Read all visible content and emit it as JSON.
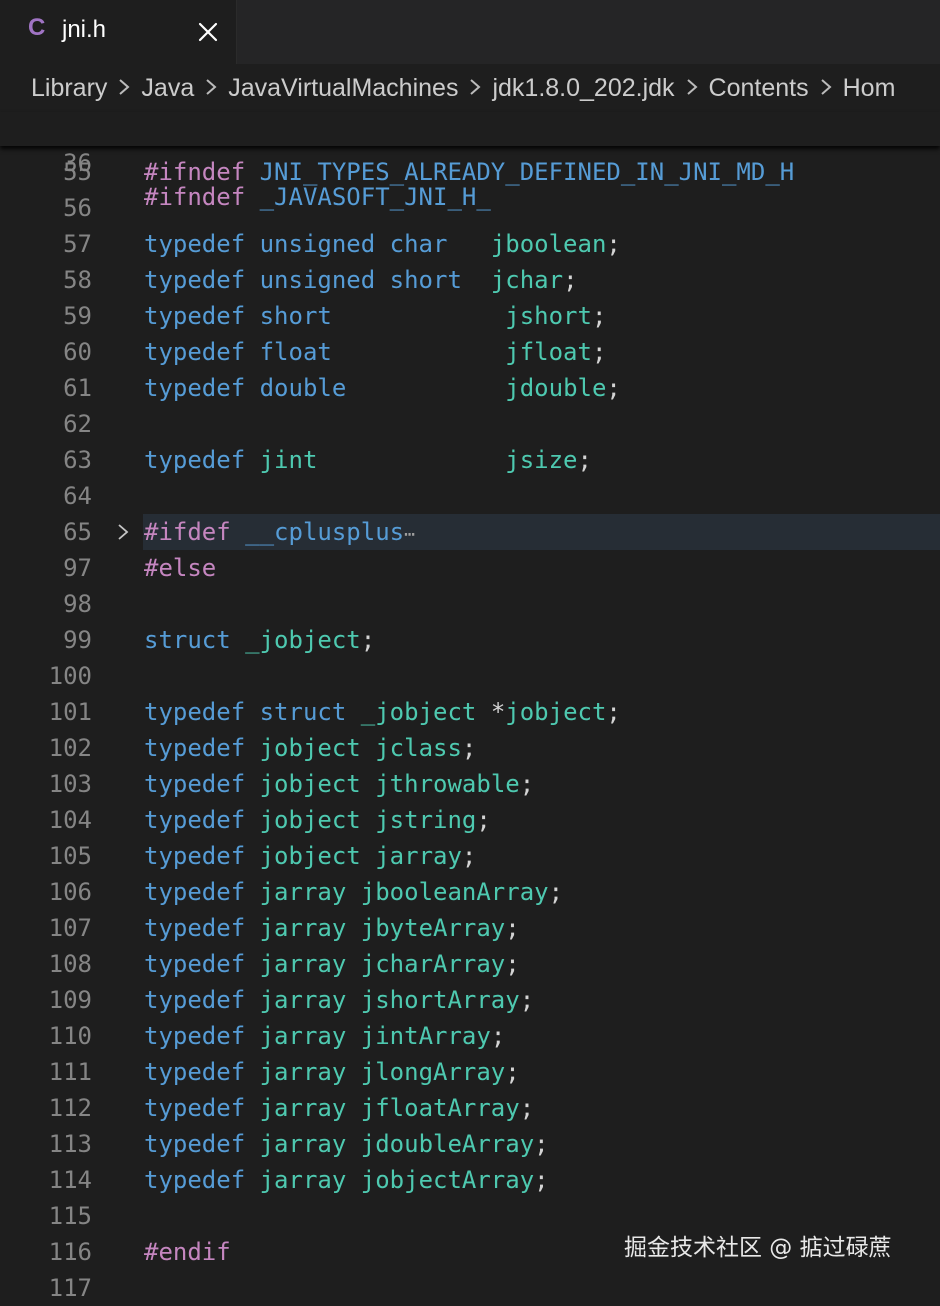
{
  "tab": {
    "lang_icon": "C",
    "filename": "jni.h",
    "close_icon": "close-icon"
  },
  "breadcrumb": [
    "Library",
    "Java",
    "JavaVirtualMachines",
    "jdk1.8.0_202.jdk",
    "Contents",
    "Hom"
  ],
  "colors": {
    "background": "#1e1e1e",
    "keyword": "#569cd6",
    "preprocessor": "#c586c0",
    "type": "#4ec9b0",
    "punctuation": "#d4d4d4",
    "line_number": "#858585"
  },
  "sticky_line": {
    "number": "36",
    "tokens": [
      {
        "t": "#ifndef",
        "c": "pp"
      },
      {
        "t": " ",
        "c": "pu"
      },
      {
        "t": "_JAVASOFT_JNI_H_",
        "c": "kw"
      }
    ]
  },
  "lines": [
    {
      "n": "55",
      "tokens": [
        {
          "t": "#ifndef",
          "c": "pp"
        },
        {
          "t": " ",
          "c": "pu"
        },
        {
          "t": "JNI_TYPES_ALREADY_DEFINED_IN_JNI_MD_H",
          "c": "kw"
        }
      ]
    },
    {
      "n": "56",
      "tokens": []
    },
    {
      "n": "57",
      "tokens": [
        {
          "t": "typedef",
          "c": "kw"
        },
        {
          "t": " ",
          "c": "pu"
        },
        {
          "t": "unsigned",
          "c": "kw"
        },
        {
          "t": " ",
          "c": "pu"
        },
        {
          "t": "char",
          "c": "kw"
        },
        {
          "t": "   ",
          "c": "pu"
        },
        {
          "t": "jboolean",
          "c": "ty"
        },
        {
          "t": ";",
          "c": "pu"
        }
      ]
    },
    {
      "n": "58",
      "tokens": [
        {
          "t": "typedef",
          "c": "kw"
        },
        {
          "t": " ",
          "c": "pu"
        },
        {
          "t": "unsigned",
          "c": "kw"
        },
        {
          "t": " ",
          "c": "pu"
        },
        {
          "t": "short",
          "c": "kw"
        },
        {
          "t": "  ",
          "c": "pu"
        },
        {
          "t": "jchar",
          "c": "ty"
        },
        {
          "t": ";",
          "c": "pu"
        }
      ]
    },
    {
      "n": "59",
      "tokens": [
        {
          "t": "typedef",
          "c": "kw"
        },
        {
          "t": " ",
          "c": "pu"
        },
        {
          "t": "short",
          "c": "kw"
        },
        {
          "t": "            ",
          "c": "pu"
        },
        {
          "t": "jshort",
          "c": "ty"
        },
        {
          "t": ";",
          "c": "pu"
        }
      ]
    },
    {
      "n": "60",
      "tokens": [
        {
          "t": "typedef",
          "c": "kw"
        },
        {
          "t": " ",
          "c": "pu"
        },
        {
          "t": "float",
          "c": "kw"
        },
        {
          "t": "            ",
          "c": "pu"
        },
        {
          "t": "jfloat",
          "c": "ty"
        },
        {
          "t": ";",
          "c": "pu"
        }
      ]
    },
    {
      "n": "61",
      "tokens": [
        {
          "t": "typedef",
          "c": "kw"
        },
        {
          "t": " ",
          "c": "pu"
        },
        {
          "t": "double",
          "c": "kw"
        },
        {
          "t": "           ",
          "c": "pu"
        },
        {
          "t": "jdouble",
          "c": "ty"
        },
        {
          "t": ";",
          "c": "pu"
        }
      ]
    },
    {
      "n": "62",
      "tokens": []
    },
    {
      "n": "63",
      "tokens": [
        {
          "t": "typedef",
          "c": "kw"
        },
        {
          "t": " ",
          "c": "pu"
        },
        {
          "t": "jint",
          "c": "ty"
        },
        {
          "t": "             ",
          "c": "pu"
        },
        {
          "t": "jsize",
          "c": "ty"
        },
        {
          "t": ";",
          "c": "pu"
        }
      ]
    },
    {
      "n": "64",
      "tokens": []
    },
    {
      "n": "65",
      "folded": true,
      "tokens": [
        {
          "t": "#ifdef",
          "c": "pp"
        },
        {
          "t": " ",
          "c": "pu"
        },
        {
          "t": "__cplusplus",
          "c": "kw"
        },
        {
          "t": "⋯",
          "c": "ell"
        }
      ]
    },
    {
      "n": "97",
      "tokens": [
        {
          "t": "#else",
          "c": "pp"
        }
      ]
    },
    {
      "n": "98",
      "tokens": []
    },
    {
      "n": "99",
      "tokens": [
        {
          "t": "struct",
          "c": "kw"
        },
        {
          "t": " ",
          "c": "pu"
        },
        {
          "t": "_jobject",
          "c": "ty"
        },
        {
          "t": ";",
          "c": "pu"
        }
      ]
    },
    {
      "n": "100",
      "tokens": []
    },
    {
      "n": "101",
      "tokens": [
        {
          "t": "typedef",
          "c": "kw"
        },
        {
          "t": " ",
          "c": "pu"
        },
        {
          "t": "struct",
          "c": "kw"
        },
        {
          "t": " ",
          "c": "pu"
        },
        {
          "t": "_jobject",
          "c": "ty"
        },
        {
          "t": " ",
          "c": "pu"
        },
        {
          "t": "*",
          "c": "pu"
        },
        {
          "t": "jobject",
          "c": "ty"
        },
        {
          "t": ";",
          "c": "pu"
        }
      ]
    },
    {
      "n": "102",
      "tokens": [
        {
          "t": "typedef",
          "c": "kw"
        },
        {
          "t": " ",
          "c": "pu"
        },
        {
          "t": "jobject",
          "c": "ty"
        },
        {
          "t": " ",
          "c": "pu"
        },
        {
          "t": "jclass",
          "c": "ty"
        },
        {
          "t": ";",
          "c": "pu"
        }
      ]
    },
    {
      "n": "103",
      "tokens": [
        {
          "t": "typedef",
          "c": "kw"
        },
        {
          "t": " ",
          "c": "pu"
        },
        {
          "t": "jobject",
          "c": "ty"
        },
        {
          "t": " ",
          "c": "pu"
        },
        {
          "t": "jthrowable",
          "c": "ty"
        },
        {
          "t": ";",
          "c": "pu"
        }
      ]
    },
    {
      "n": "104",
      "tokens": [
        {
          "t": "typedef",
          "c": "kw"
        },
        {
          "t": " ",
          "c": "pu"
        },
        {
          "t": "jobject",
          "c": "ty"
        },
        {
          "t": " ",
          "c": "pu"
        },
        {
          "t": "jstring",
          "c": "ty"
        },
        {
          "t": ";",
          "c": "pu"
        }
      ]
    },
    {
      "n": "105",
      "tokens": [
        {
          "t": "typedef",
          "c": "kw"
        },
        {
          "t": " ",
          "c": "pu"
        },
        {
          "t": "jobject",
          "c": "ty"
        },
        {
          "t": " ",
          "c": "pu"
        },
        {
          "t": "jarray",
          "c": "ty"
        },
        {
          "t": ";",
          "c": "pu"
        }
      ]
    },
    {
      "n": "106",
      "tokens": [
        {
          "t": "typedef",
          "c": "kw"
        },
        {
          "t": " ",
          "c": "pu"
        },
        {
          "t": "jarray",
          "c": "ty"
        },
        {
          "t": " ",
          "c": "pu"
        },
        {
          "t": "jbooleanArray",
          "c": "ty"
        },
        {
          "t": ";",
          "c": "pu"
        }
      ]
    },
    {
      "n": "107",
      "tokens": [
        {
          "t": "typedef",
          "c": "kw"
        },
        {
          "t": " ",
          "c": "pu"
        },
        {
          "t": "jarray",
          "c": "ty"
        },
        {
          "t": " ",
          "c": "pu"
        },
        {
          "t": "jbyteArray",
          "c": "ty"
        },
        {
          "t": ";",
          "c": "pu"
        }
      ]
    },
    {
      "n": "108",
      "tokens": [
        {
          "t": "typedef",
          "c": "kw"
        },
        {
          "t": " ",
          "c": "pu"
        },
        {
          "t": "jarray",
          "c": "ty"
        },
        {
          "t": " ",
          "c": "pu"
        },
        {
          "t": "jcharArray",
          "c": "ty"
        },
        {
          "t": ";",
          "c": "pu"
        }
      ]
    },
    {
      "n": "109",
      "tokens": [
        {
          "t": "typedef",
          "c": "kw"
        },
        {
          "t": " ",
          "c": "pu"
        },
        {
          "t": "jarray",
          "c": "ty"
        },
        {
          "t": " ",
          "c": "pu"
        },
        {
          "t": "jshortArray",
          "c": "ty"
        },
        {
          "t": ";",
          "c": "pu"
        }
      ]
    },
    {
      "n": "110",
      "tokens": [
        {
          "t": "typedef",
          "c": "kw"
        },
        {
          "t": " ",
          "c": "pu"
        },
        {
          "t": "jarray",
          "c": "ty"
        },
        {
          "t": " ",
          "c": "pu"
        },
        {
          "t": "jintArray",
          "c": "ty"
        },
        {
          "t": ";",
          "c": "pu"
        }
      ]
    },
    {
      "n": "111",
      "tokens": [
        {
          "t": "typedef",
          "c": "kw"
        },
        {
          "t": " ",
          "c": "pu"
        },
        {
          "t": "jarray",
          "c": "ty"
        },
        {
          "t": " ",
          "c": "pu"
        },
        {
          "t": "jlongArray",
          "c": "ty"
        },
        {
          "t": ";",
          "c": "pu"
        }
      ]
    },
    {
      "n": "112",
      "tokens": [
        {
          "t": "typedef",
          "c": "kw"
        },
        {
          "t": " ",
          "c": "pu"
        },
        {
          "t": "jarray",
          "c": "ty"
        },
        {
          "t": " ",
          "c": "pu"
        },
        {
          "t": "jfloatArray",
          "c": "ty"
        },
        {
          "t": ";",
          "c": "pu"
        }
      ]
    },
    {
      "n": "113",
      "tokens": [
        {
          "t": "typedef",
          "c": "kw"
        },
        {
          "t": " ",
          "c": "pu"
        },
        {
          "t": "jarray",
          "c": "ty"
        },
        {
          "t": " ",
          "c": "pu"
        },
        {
          "t": "jdoubleArray",
          "c": "ty"
        },
        {
          "t": ";",
          "c": "pu"
        }
      ]
    },
    {
      "n": "114",
      "tokens": [
        {
          "t": "typedef",
          "c": "kw"
        },
        {
          "t": " ",
          "c": "pu"
        },
        {
          "t": "jarray",
          "c": "ty"
        },
        {
          "t": " ",
          "c": "pu"
        },
        {
          "t": "jobjectArray",
          "c": "ty"
        },
        {
          "t": ";",
          "c": "pu"
        }
      ]
    },
    {
      "n": "115",
      "tokens": []
    },
    {
      "n": "116",
      "tokens": [
        {
          "t": "#endif",
          "c": "pp"
        }
      ]
    },
    {
      "n": "117",
      "tokens": []
    }
  ],
  "watermark": "掘金技术社区 @ 掂过碌蔗"
}
